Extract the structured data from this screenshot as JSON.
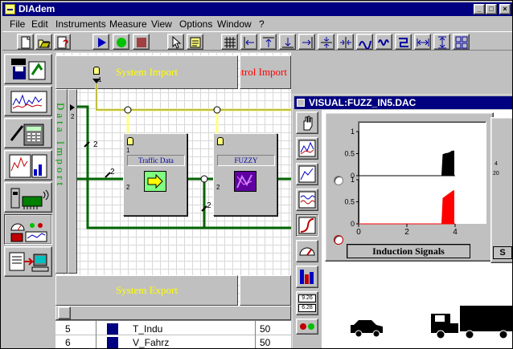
{
  "app": {
    "title": "DIAdem"
  },
  "window_buttons": {
    "minimize": "_",
    "maximize": "□",
    "close": "×"
  },
  "menu": [
    {
      "label": "File"
    },
    {
      "label": "Edit"
    },
    {
      "label": "Instruments"
    },
    {
      "label": "Measure"
    },
    {
      "label": "View"
    },
    {
      "label": "Options"
    },
    {
      "label": "Window"
    },
    {
      "label": "?"
    }
  ],
  "toolbar": {
    "icons": [
      "new-document-icon",
      "open-folder-icon",
      "help-document-icon",
      "play-icon",
      "record-icon",
      "stop-icon",
      "pointer-icon",
      "properties-icon",
      "grid-icon",
      "align-left-icon",
      "align-top-icon",
      "align-bottom-icon",
      "align-right-icon",
      "center-horizontal-icon",
      "center-vertical-icon",
      "distribute-icon",
      "wave-icon",
      "route-icon",
      "space-horizontal-icon",
      "space-vertical-icon",
      "tile-icon"
    ]
  },
  "colors": {
    "title_blue": "#000080",
    "import_yellow": "#ffff00",
    "control_red": "#ff0000",
    "data_green": "#00a000",
    "wire_yellow": "#ffff80",
    "wire_green": "#006400"
  },
  "canvas": {
    "system_import": "System Import",
    "control_import": "Control Import",
    "data_import": "Data Import",
    "system_export": "System Export",
    "blocks": [
      {
        "label": "Traffic Data"
      },
      {
        "label": "FUZZY"
      }
    ],
    "channel_marks": [
      "2",
      "2",
      "2",
      "2",
      "2",
      "2",
      "1",
      "1"
    ]
  },
  "table": {
    "rows": [
      {
        "num": "5",
        "name": "T_Indu",
        "value": "50"
      },
      {
        "num": "6",
        "name": "V_Fahrz",
        "value": "50"
      }
    ]
  },
  "visual": {
    "title": "VISUAL:FUZZ_IN5.DAC",
    "caption": "Induction Signals",
    "readouts": [
      "9.26",
      "6.28"
    ],
    "side_labels": [
      "4",
      "20",
      "S"
    ]
  },
  "chart_data": {
    "type": "area",
    "title": "Induction Signals",
    "xlabel": "",
    "ylabel": "",
    "xlim": [
      0,
      4
    ],
    "x_ticks": [
      "0",
      "2",
      "4"
    ],
    "panels": [
      {
        "ylim": [
          0,
          1
        ],
        "y_ticks": [
          "0",
          "0.5",
          "1"
        ],
        "color": "#000000",
        "x": [
          0,
          3.45,
          3.5,
          3.6,
          3.7,
          3.8,
          3.85,
          3.9,
          3.95
        ],
        "y": [
          0,
          0,
          0.48,
          0.5,
          0.51,
          0.53,
          0.55,
          0.56,
          0.56
        ]
      },
      {
        "ylim": [
          0,
          1
        ],
        "y_ticks": [
          "0",
          "0.5",
          "1"
        ],
        "color": "#ff0000",
        "x": [
          0,
          3.45,
          3.5,
          3.6,
          3.7,
          3.8,
          3.85,
          3.9,
          3.95
        ],
        "y": [
          0,
          0,
          0.58,
          0.62,
          0.66,
          0.7,
          0.72,
          0.74,
          0.75
        ]
      }
    ]
  }
}
